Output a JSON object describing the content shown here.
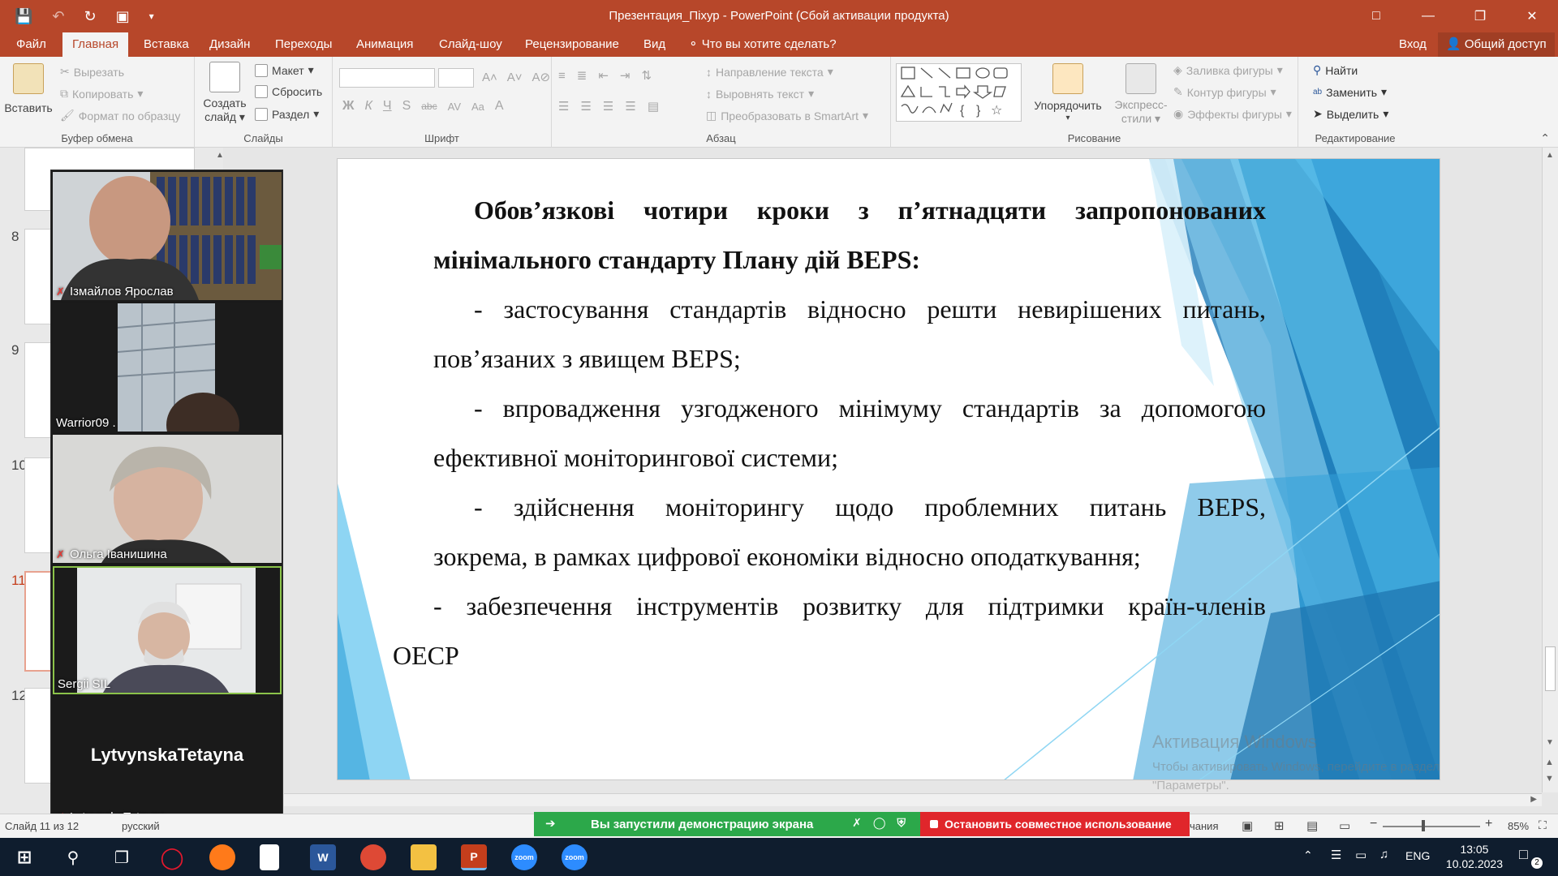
{
  "titlebar": {
    "title": "Презентация_Піхур - PowerPoint (Сбой активации продукта)"
  },
  "tabs": [
    {
      "label": "Файл"
    },
    {
      "label": "Главная"
    },
    {
      "label": "Вставка"
    },
    {
      "label": "Дизайн"
    },
    {
      "label": "Переходы"
    },
    {
      "label": "Анимация"
    },
    {
      "label": "Слайд-шоу"
    },
    {
      "label": "Рецензирование"
    },
    {
      "label": "Вид"
    }
  ],
  "tell_me": "Что вы хотите сделать?",
  "signin": "Вход",
  "share": "Общий доступ",
  "ribbon": {
    "clipboard": {
      "label": "Буфер обмена",
      "paste": "Вставить",
      "cut": "Вырезать",
      "copy": "Копировать",
      "format_painter": "Формат по образцу"
    },
    "slides": {
      "label": "Слайды",
      "new_slide_1": "Создать",
      "new_slide_2": "слайд",
      "layout": "Макет",
      "reset": "Сбросить",
      "section": "Раздел"
    },
    "font": {
      "label": "Шрифт"
    },
    "paragraph": {
      "label": "Абзац",
      "text_direction": "Направление текста",
      "align_text": "Выровнять текст",
      "smartart": "Преобразовать в SmartArt"
    },
    "drawing": {
      "label": "Рисование",
      "arrange": "Упорядочить",
      "quick_styles_1": "Экспресс-",
      "quick_styles_2": "стили",
      "shape_fill": "Заливка фигуры",
      "shape_outline": "Контур фигуры",
      "shape_effects": "Эффекты фигуры"
    },
    "editing": {
      "label": "Редактирование",
      "find": "Найти",
      "replace": "Заменить",
      "select": "Выделить"
    }
  },
  "thumbnails": {
    "numbers": [
      "8",
      "9",
      "10",
      "11",
      "12"
    ],
    "selected": "11"
  },
  "zoom": {
    "participants": [
      {
        "name": "Ізмайлов Ярослав",
        "muted": true
      },
      {
        "name": "Warrior09 .",
        "muted": false
      },
      {
        "name": "Ольга Іванишина",
        "muted": true
      },
      {
        "name": "Sergii SIL",
        "muted": false
      },
      {
        "name": "LytvynskaTetayna",
        "muted": true,
        "display_name_large": "LytvynskaTetayna"
      }
    ]
  },
  "slide": {
    "heading_line1": "Обов’язкові чотири кроки з п’ятнадцяти запропонованих",
    "heading_line2": "мінімального стандарту Плану дій BEPS:",
    "item1_line1": "- застосування стандартів відносно решти невирішених питань,",
    "item1_line2": "пов’язаних з явищем BEPS;",
    "item2_line1": "- впровадження узгодженого мінімуму стандартів за допомогою",
    "item2_line2": "ефективної моніторингової системи;",
    "item3_line1": "- здійснення моніторингу щодо проблемних питань BEPS,",
    "item3_line2": "зокрема, в рамках цифрової економіки відносно оподаткування;",
    "item4_line1": "- забезпечення інструментів розвитку для підтримки країн-членів",
    "item4_line2": "ОЕСР",
    "watermark_title": "Активация Windows",
    "watermark_sub1": "Чтобы активировать Windows, перейдите в раздел",
    "watermark_sub2": "\"Параметры\"."
  },
  "status": {
    "slide_info": "Слайд 11 из 12",
    "lang": "русский",
    "notes_partial": "чания",
    "zoom": "85%"
  },
  "sharebar": {
    "message": "Вы запустили демонстрацию экрана",
    "stop": "Остановить совместное использование"
  },
  "taskbar": {
    "lang": "ENG",
    "time": "13:05",
    "date": "10.02.2023",
    "notifications": "2"
  }
}
